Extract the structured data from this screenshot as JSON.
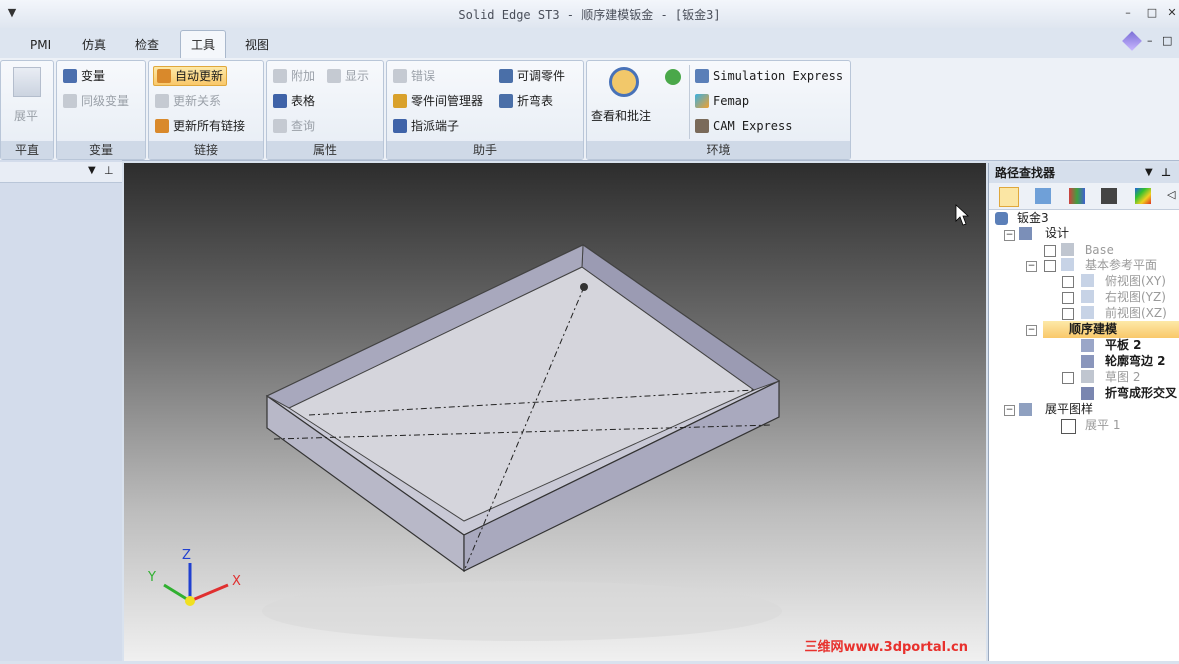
{
  "window": {
    "title": "Solid Edge ST3 - 顺序建模钣金 - [钣金3]",
    "menu_glyph": "▼",
    "min": "–",
    "max": "□",
    "close": "✕"
  },
  "tabs": [
    "PMI",
    "仿真",
    "检查",
    "工具",
    "视图"
  ],
  "active_tab": "工具",
  "ribbon": {
    "flatten": {
      "button": "展平",
      "label": "平直"
    },
    "variables": {
      "items": [
        "变量",
        "同级变量"
      ],
      "label": "变量"
    },
    "links": {
      "items": [
        "自动更新",
        "更新关系",
        "更新所有链接"
      ],
      "label": "链接"
    },
    "properties": {
      "attach": "附加",
      "show": "显示",
      "table": "表格",
      "query": "查询",
      "label": "属性"
    },
    "assistant": {
      "error": "错误",
      "part_manager": "零件间管理器",
      "assign_terminal": "指派端子",
      "adjustable_part": "可调零件",
      "bend_table": "折弯表",
      "label": "助手"
    },
    "environment": {
      "review": "查看和批注",
      "sim": "Simulation Express",
      "femap": "Femap",
      "cam": "CAM Express",
      "label": "环境"
    }
  },
  "pathfinder": {
    "title": "路径查找器",
    "nodes": [
      {
        "text": "钣金3"
      },
      {
        "text": "设计"
      },
      {
        "text": "Base"
      },
      {
        "text": "基本参考平面"
      },
      {
        "text": "俯视图(XY)"
      },
      {
        "text": "右视图(YZ)"
      },
      {
        "text": "前视图(XZ)"
      },
      {
        "text": "顺序建模"
      },
      {
        "text": "平板 2"
      },
      {
        "text": "轮廓弯边 2"
      },
      {
        "text": "草图 2"
      },
      {
        "text": "折弯成形交叉"
      },
      {
        "text": "展平图样"
      },
      {
        "text": "展平 1"
      }
    ]
  },
  "triad": {
    "x": "X",
    "y": "Y",
    "z": "Z"
  },
  "watermark": "三维网www.3dportal.cn",
  "colors": {
    "accent": "#f9c86a",
    "ribbon_bg": "#edf1f7",
    "x_axis": "#e03030",
    "y_axis": "#30b030",
    "z_axis": "#2040d0"
  }
}
